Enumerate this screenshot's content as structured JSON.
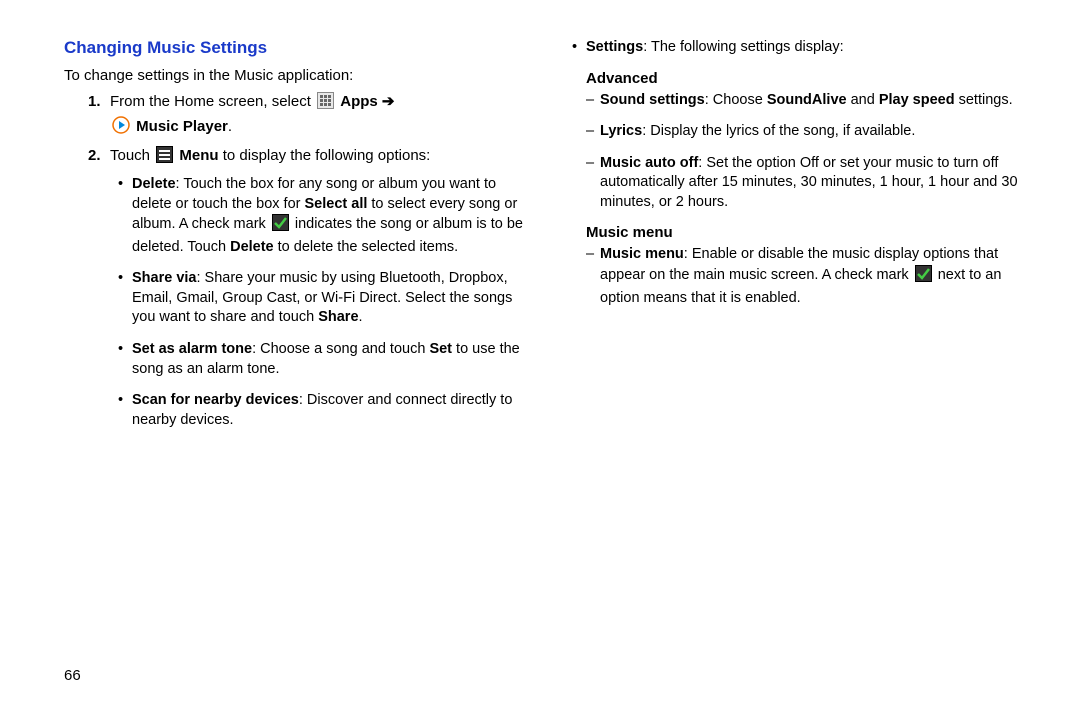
{
  "section_title": "Changing Music Settings",
  "intro": "To change settings in the Music application:",
  "step1": {
    "num": "1.",
    "pre": "From the Home screen, select ",
    "apps": "Apps",
    "arrow": "➔",
    "music_player": "Music Player",
    "period": "."
  },
  "step2": {
    "num": "2.",
    "pre": "Touch ",
    "menu": "Menu",
    "post": " to display the following options:"
  },
  "bullets_left": {
    "delete": {
      "label": "Delete",
      "t1": ": Touch the box for any song or album you want to delete or touch the box for ",
      "select_all": "Select all",
      "t2": " to select every song or album. A check mark ",
      "t3": " indicates the song or album is to be deleted. Touch ",
      "del2": "Delete",
      "t4": " to delete the selected items."
    },
    "share": {
      "label": "Share via",
      "t1": ": Share your music by using Bluetooth, Dropbox, Email, Gmail, Group Cast, or Wi-Fi Direct. Select the songs you want to share and touch ",
      "share_b": "Share",
      "t2": "."
    },
    "alarm": {
      "label": "Set as alarm tone",
      "t1": ": Choose a song and touch ",
      "set": "Set",
      "t2": " to use the song as an alarm tone."
    },
    "scan": {
      "label": "Scan for nearby devices",
      "t1": ": Discover and connect directly to nearby devices."
    }
  },
  "right": {
    "settings_label": "Settings",
    "settings_text": ": The following settings display:",
    "advanced_heading": "Advanced",
    "sound": {
      "label": "Sound settings",
      "t1": ": Choose ",
      "sa": "SoundAlive",
      "and": " and ",
      "ps": "Play speed",
      "t2": " settings."
    },
    "lyrics": {
      "label": "Lyrics",
      "t1": ": Display the lyrics of the song, if available."
    },
    "auto_off": {
      "label": "Music auto off",
      "t1": ": Set the option Off or set your music to turn off automatically after 15 minutes, 30 minutes, 1 hour, 1 hour and 30 minutes, or 2 hours."
    },
    "music_menu_heading": "Music menu",
    "music_menu": {
      "label": "Music menu",
      "t1": ": Enable or disable the music display options that appear on the main music screen. A check mark ",
      "t2": " next to an option means that it is enabled."
    }
  },
  "page_number": "66"
}
